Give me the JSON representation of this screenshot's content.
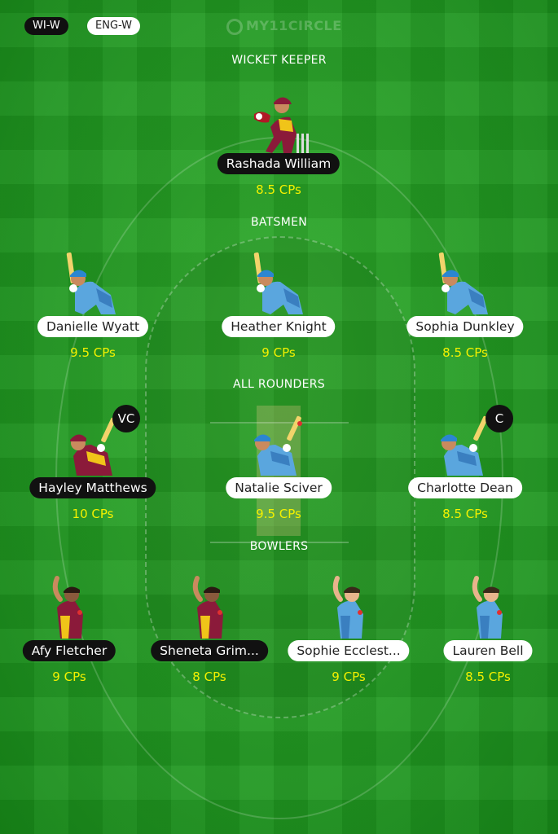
{
  "header": {
    "team_a": "WI-W",
    "team_b": "ENG-W",
    "logo_text": "MY11CIRCLE"
  },
  "sections": {
    "wicket_keeper": "WICKET KEEPER",
    "batsmen": "BATSMEN",
    "all_rounders": "ALL ROUNDERS",
    "bowlers": "BOWLERS"
  },
  "players": {
    "wk1": {
      "name": "Rashada William",
      "credits": "8.5 CPs",
      "team": "WI-W",
      "role": "wicket-keeper"
    },
    "bat1": {
      "name": "Danielle Wyatt",
      "credits": "9.5 CPs",
      "team": "ENG-W",
      "role": "batsman"
    },
    "bat2": {
      "name": "Heather Knight",
      "credits": "9 CPs",
      "team": "ENG-W",
      "role": "batsman"
    },
    "bat3": {
      "name": "Sophia Dunkley",
      "credits": "8.5 CPs",
      "team": "ENG-W",
      "role": "batsman"
    },
    "ar1": {
      "name": "Hayley Matthews",
      "credits": "10 CPs",
      "team": "WI-W",
      "role": "all-rounder",
      "badge": "VC"
    },
    "ar2": {
      "name": "Natalie Sciver",
      "credits": "9.5 CPs",
      "team": "ENG-W",
      "role": "all-rounder"
    },
    "ar3": {
      "name": "Charlotte Dean",
      "credits": "8.5 CPs",
      "team": "ENG-W",
      "role": "all-rounder",
      "badge": "C"
    },
    "bowl1": {
      "name": "Afy Fletcher",
      "credits": "9 CPs",
      "team": "WI-W",
      "role": "bowler"
    },
    "bowl2": {
      "name": "Sheneta Grim...",
      "credits": "8 CPs",
      "team": "WI-W",
      "role": "bowler"
    },
    "bowl3": {
      "name": "Sophie Ecclest...",
      "credits": "9 CPs",
      "team": "ENG-W",
      "role": "bowler"
    },
    "bowl4": {
      "name": "Lauren Bell",
      "credits": "8.5 CPs",
      "team": "ENG-W",
      "role": "bowler"
    }
  },
  "colors": {
    "field_green": "#1f9a1f",
    "credit_yellow": "#f4f100",
    "wi_jersey": "#8b1a3a",
    "eng_jersey": "#5aa6de"
  },
  "icons": {
    "wicket_keeper": "wicket-keeper-icon",
    "batsman": "batsman-icon",
    "all_rounder": "all-rounder-icon",
    "bowler": "bowler-icon"
  }
}
